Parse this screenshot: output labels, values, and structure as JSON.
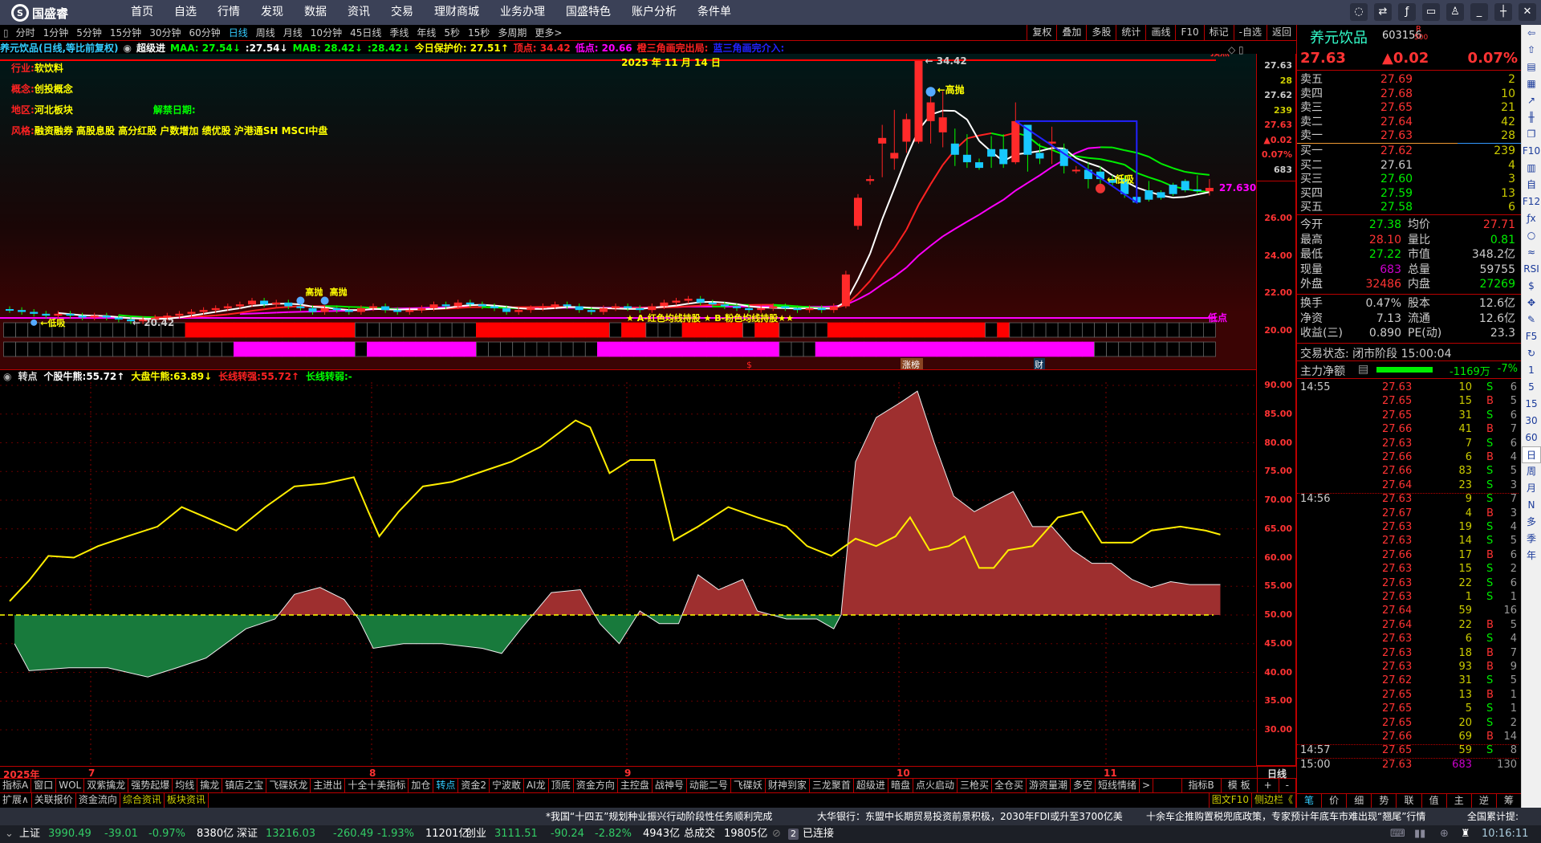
{
  "topbar": {
    "logo": "国盛睿",
    "menu": [
      "首页",
      "自选",
      "行情",
      "发现",
      "数据",
      "资讯",
      "交易",
      "理财商城",
      "业务办理",
      "国盛特色",
      "账户分析",
      "条件单"
    ],
    "window_icons": [
      "chat-icon",
      "swap-icon",
      "fx-icon",
      "monitor-icon",
      "shirt-icon",
      "minimize-icon",
      "restore-icon",
      "close-icon"
    ]
  },
  "periods": {
    "items": [
      "分时",
      "1分钟",
      "5分钟",
      "15分钟",
      "30分钟",
      "60分钟",
      "日线",
      "周线",
      "月线",
      "10分钟",
      "45日线",
      "季线",
      "年线",
      "5秒",
      "15秒",
      "多周期",
      "更多>"
    ],
    "active": "日线",
    "tools": [
      "复权",
      "叠加",
      "多股",
      "统计",
      "画线",
      "F10",
      "标记",
      "-自选",
      "返回"
    ]
  },
  "info": {
    "title": "养元饮品(日线,等比前复权)",
    "indicator": "超级进",
    "maa": "MAA: 27.54↓",
    "maa2": ":27.54↓",
    "mab": "MAB: 28.42↓",
    "mab2": ":28.42↓",
    "protect": "今日保护价: 27.51↑",
    "top": "顶点: 34.42",
    "low": "低点: 20.66",
    "orange_tri": "橙三角画完出局:",
    "blue_tri": "蓝三角画完介入:"
  },
  "overlay": {
    "industry_k": "行业:",
    "industry": "软饮料",
    "concept_k": "概念:",
    "concept": "创投概念",
    "region_k": "地区:",
    "region": "河北板块",
    "unlock_k": "解禁日期:",
    "style_k": "风格:",
    "style": "融资融券 高股息股 高分红股 户数增加 绩优股 沪港通SH MSCI中盘"
  },
  "chart_labels": {
    "date": "2025 年 11 月 14 日",
    "peak": "34.42",
    "low": "20.42",
    "last": "27.630",
    "sell_top": "顶点",
    "buy_low": "低点",
    "high_sell": "高抛",
    "low_buy": "低吸",
    "legend": "★ A-红色均线持股 ★ B-粉色均线持股★★",
    "marker_dollar": "$",
    "marker_rank": "涨榜",
    "marker_fin": "财"
  },
  "price_axis": {
    "quote": [
      "27.63",
      "28",
      "27.62",
      "239",
      "27.63",
      "▲0.02",
      "0.07%",
      "683"
    ],
    "ticks": [
      "26.00",
      "24.00",
      "22.00",
      "20.00"
    ]
  },
  "candles": {
    "flat_closes": [
      21.1,
      21.0,
      20.9,
      20.8,
      20.9,
      20.8,
      20.7,
      20.8,
      20.7,
      20.6,
      20.5,
      20.6,
      20.7,
      20.8,
      20.9,
      21.0,
      21.1,
      21.2,
      21.3,
      21.4,
      21.6,
      21.4,
      21.5,
      21.3,
      21.2,
      21.0,
      21.2,
      21.1,
      21.0,
      21.2,
      21.3,
      21.1,
      21.0,
      21.1,
      21.2,
      21.4,
      21.3,
      21.5,
      21.4,
      21.3,
      21.2,
      21.0,
      21.1,
      21.2,
      21.3,
      21.4,
      21.3,
      21.1,
      21.0,
      21.2,
      21.3,
      21.2,
      21.1,
      21.3,
      21.5,
      21.6,
      21.7,
      21.5,
      21.4,
      21.3,
      21.2,
      21.1,
      21.2,
      21.3,
      21.2,
      21.1,
      21.2,
      21.1,
      21.3
    ],
    "ohlc_tail": [
      [
        21.3,
        23.0,
        23.2,
        21.2
      ],
      [
        25.6,
        27.1,
        27.3,
        25.4
      ],
      [
        28.0,
        28.1,
        28.3,
        27.8
      ],
      [
        30.0,
        30.3,
        31.0,
        28.2
      ],
      [
        29.2,
        29.5,
        31.8,
        28.6
      ],
      [
        30.1,
        31.3,
        31.6,
        29.5
      ],
      [
        30.1,
        34.42,
        34.42,
        30.0
      ],
      [
        31.2,
        32.2,
        32.6,
        30.0
      ],
      [
        30.6,
        31.4,
        32.8,
        29.8
      ],
      [
        30.0,
        29.4,
        30.8,
        28.8
      ],
      [
        29.4,
        29.0,
        30.5,
        28.7
      ],
      [
        29.0,
        28.7,
        29.2,
        28.6
      ],
      [
        29.7,
        29.3,
        30.4,
        28.7
      ],
      [
        29.7,
        28.9,
        30.5,
        28.7
      ],
      [
        29.0,
        31.2,
        32.2,
        28.9
      ],
      [
        31.0,
        29.4,
        31.0,
        28.5
      ],
      [
        29.5,
        29.2,
        30.0,
        28.9
      ],
      [
        30.0,
        30.1,
        30.9,
        28.9
      ],
      [
        29.7,
        28.8,
        30.0,
        28.4
      ],
      [
        28.6,
        28.6,
        28.8,
        28.4
      ],
      [
        28.6,
        28.1,
        29.0,
        27.6
      ],
      [
        28.5,
        28.1,
        28.8,
        27.8
      ],
      [
        28.1,
        27.9,
        28.3,
        27.7
      ],
      [
        28.1,
        27.3,
        28.3,
        27.1
      ],
      [
        27.15,
        26.85,
        27.2,
        26.8
      ],
      [
        27.5,
        27.0,
        28.0,
        26.9
      ],
      [
        27.4,
        27.1,
        27.5,
        27.0
      ],
      [
        27.8,
        27.3,
        27.9,
        27.2
      ],
      [
        28.0,
        27.5,
        28.1,
        27.4
      ],
      [
        27.55,
        27.5,
        28.3,
        27.3
      ],
      [
        27.45,
        27.63,
        28.1,
        27.22
      ]
    ]
  },
  "signal_rows": {
    "red_runs": [
      [
        15,
        29
      ],
      [
        39,
        50
      ],
      [
        51,
        53
      ],
      [
        56,
        61
      ],
      [
        62,
        64
      ],
      [
        68,
        81
      ],
      [
        82,
        83
      ]
    ],
    "magenta_runs": [
      [
        19,
        29
      ],
      [
        30,
        39
      ],
      [
        49,
        64
      ],
      [
        67,
        90
      ]
    ],
    "count": 100
  },
  "colors": {
    "up": "#ff2a2a",
    "down": "#18c8ff",
    "red_row": "#ff0000",
    "magenta_row": "#ff00ff",
    "area_up": "#9e2f2f",
    "area_down": "#187a3c",
    "yellow": "#ffee00"
  },
  "indicator": {
    "name": "转点",
    "bull_k": "个股牛熊:",
    "bull": "55.72↑",
    "mkt_k": "大盘牛熊:",
    "mkt": "63.89↓",
    "strong_k": "长线转强:",
    "strong": "55.72↑",
    "weak_k": "长线转弱:",
    "weak": "-",
    "yellow_line": [
      [
        0,
        52.4
      ],
      [
        1.6,
        56
      ],
      [
        3.2,
        60.3
      ],
      [
        5.3,
        60
      ],
      [
        7.3,
        62
      ],
      [
        9.7,
        63.7
      ],
      [
        12.2,
        65.4
      ],
      [
        14.2,
        68.8
      ],
      [
        16.2,
        67
      ],
      [
        18.7,
        64.7
      ],
      [
        21.1,
        68.8
      ],
      [
        23.5,
        72.4
      ],
      [
        26,
        72.9
      ],
      [
        28.4,
        74
      ],
      [
        29.6,
        68
      ],
      [
        30.5,
        63.7
      ],
      [
        32.1,
        68
      ],
      [
        34.1,
        72.4
      ],
      [
        36.5,
        73.2
      ],
      [
        39,
        75
      ],
      [
        41.4,
        76.7
      ],
      [
        43.8,
        79.3
      ],
      [
        46.7,
        83.9
      ],
      [
        47.9,
        82.7
      ],
      [
        49.5,
        74.7
      ],
      [
        51.2,
        77
      ],
      [
        53.2,
        77
      ],
      [
        54.8,
        63
      ],
      [
        56.8,
        65.4
      ],
      [
        59.3,
        68.8
      ],
      [
        61.7,
        67
      ],
      [
        64.1,
        65.4
      ],
      [
        65.8,
        62
      ],
      [
        67.8,
        60.3
      ],
      [
        69.8,
        63.3
      ],
      [
        71.5,
        62
      ],
      [
        73.1,
        63.7
      ],
      [
        74.3,
        67
      ],
      [
        75.9,
        61.3
      ],
      [
        77.5,
        62
      ],
      [
        78.8,
        63.7
      ],
      [
        80,
        58.2
      ],
      [
        81.2,
        58.2
      ],
      [
        82.4,
        61.3
      ],
      [
        84.4,
        62
      ],
      [
        86.5,
        67
      ],
      [
        88.5,
        68
      ],
      [
        90.1,
        62.6
      ],
      [
        92.6,
        62.6
      ],
      [
        94.2,
        64.7
      ],
      [
        96.6,
        65.4
      ],
      [
        98.7,
        64.7
      ],
      [
        99.9,
        64
      ]
    ],
    "area_line": [
      [
        0.4,
        45
      ],
      [
        1.6,
        40.3
      ],
      [
        4.9,
        40.8
      ],
      [
        8.1,
        40.8
      ],
      [
        11.4,
        39.2
      ],
      [
        13.8,
        40.8
      ],
      [
        16.2,
        42.5
      ],
      [
        19.5,
        47.6
      ],
      [
        21.9,
        49.3
      ],
      [
        23.5,
        53.6
      ],
      [
        25.6,
        54.8
      ],
      [
        27.6,
        52.7
      ],
      [
        28.8,
        49.3
      ],
      [
        30,
        44.2
      ],
      [
        32.5,
        45
      ],
      [
        35.7,
        45
      ],
      [
        39,
        44.2
      ],
      [
        40.6,
        43.3
      ],
      [
        42.2,
        47.6
      ],
      [
        44.7,
        53.9
      ],
      [
        47.1,
        54.4
      ],
      [
        48.7,
        48.5
      ],
      [
        50.3,
        45
      ],
      [
        52,
        50.7
      ],
      [
        53.6,
        48.5
      ],
      [
        55.2,
        48.5
      ],
      [
        56.8,
        57
      ],
      [
        58.5,
        54.4
      ],
      [
        60.5,
        56.2
      ],
      [
        61.7,
        50.7
      ],
      [
        64.1,
        49.3
      ],
      [
        66.6,
        49.3
      ],
      [
        68,
        47.6
      ],
      [
        68.6,
        50
      ],
      [
        69.8,
        76.7
      ],
      [
        71.5,
        84.4
      ],
      [
        73.5,
        87
      ],
      [
        74.9,
        89
      ],
      [
        76.3,
        80
      ],
      [
        77.9,
        70.7
      ],
      [
        79.6,
        68
      ],
      [
        81.2,
        69.8
      ],
      [
        82.8,
        71.5
      ],
      [
        84.4,
        65.4
      ],
      [
        86,
        65.4
      ],
      [
        87.7,
        61.3
      ],
      [
        89.3,
        59
      ],
      [
        90.9,
        59
      ],
      [
        92.6,
        56.2
      ],
      [
        94.2,
        54.8
      ],
      [
        95.8,
        55.8
      ],
      [
        97.4,
        55.3
      ],
      [
        99.9,
        55.3
      ]
    ],
    "ticks": [
      "90.00",
      "85.00",
      "80.00",
      "75.00",
      "70.00",
      "65.00",
      "60.00",
      "55.00",
      "50.00",
      "45.00",
      "40.00",
      "35.00",
      "30.00"
    ]
  },
  "date_axis": {
    "year": "2025年",
    "months": [
      "7",
      "8",
      "9",
      "10",
      "11"
    ],
    "period": "日线"
  },
  "tabs_row1": [
    "指标A",
    "窗口",
    "WOL",
    "双紫擒龙",
    "强势起爆",
    "均线",
    "擒龙",
    "镇店之宝",
    "飞碟妖龙",
    "主进出",
    "十全十美指标",
    "加仓",
    "转点",
    "资金2",
    "宁波敢",
    "AI龙",
    "顶底",
    "资金方向",
    "主控盘",
    "战神号",
    "动能二号",
    "飞碟妖",
    "财神到家",
    "三龙聚首",
    "超级进",
    "暗盘",
    "点火启动",
    "三枪买",
    "全仓买",
    "游资量潮",
    "多空",
    "短线情绪",
    ">"
  ],
  "tabs_row1_right": [
    "指标B",
    "模 板",
    "+",
    "-"
  ],
  "tabs_row1_active": "转点",
  "tabs_row2": [
    "扩展∧",
    "关联报价",
    "资金流向",
    "综合资讯",
    "板块资讯"
  ],
  "tabs_row2_right": [
    "图文F10",
    "侧边栏《"
  ],
  "news": [
    "*我国“十四五”规划种业振兴行动阶段性任务顺利完成",
    "大华银行：东盟中长期贸易投资前景积极，2030年FDI或升至3700亿美",
    "十余车企推购置税兜底政策，专家预计年底车市难出现“翘尾”行情",
    "全国累计提:"
  ],
  "status": {
    "sh": [
      "上证",
      "3990.49",
      "-39.01",
      "-0.97%",
      "8380亿"
    ],
    "sz": [
      "深证",
      "13216.03",
      "-260.49",
      "-1.93%",
      "11201亿"
    ],
    "cy": [
      "创业",
      "3111.51",
      "-90.24",
      "-2.82%",
      "4943亿"
    ],
    "total_k": "总成交",
    "total": "19805亿",
    "conn_num": "2",
    "conn": "已连接",
    "time": "10:16:11"
  },
  "quote": {
    "name": "养元饮品",
    "code": "603156",
    "badge_r": "R",
    "badge_n": "500",
    "price": "27.63",
    "change": "▲0.02",
    "pct": "0.07%",
    "asks": [
      [
        "卖五",
        "27.69",
        "2"
      ],
      [
        "卖四",
        "27.68",
        "10"
      ],
      [
        "卖三",
        "27.65",
        "21"
      ],
      [
        "卖二",
        "27.64",
        "42"
      ],
      [
        "卖一",
        "27.63",
        "28"
      ]
    ],
    "bids": [
      [
        "买一",
        "27.62",
        "239"
      ],
      [
        "买二",
        "27.61",
        "4"
      ],
      [
        "买三",
        "27.60",
        "3"
      ],
      [
        "买四",
        "27.59",
        "13"
      ],
      [
        "买五",
        "27.58",
        "6"
      ]
    ],
    "stats": [
      [
        "今开",
        "27.38",
        "均价",
        "27.71"
      ],
      [
        "最高",
        "28.10",
        "量比",
        "0.81"
      ],
      [
        "最低",
        "27.22",
        "市值",
        "348.2亿"
      ],
      [
        "现量",
        "683",
        "总量",
        "59755"
      ],
      [
        "外盘",
        "32486",
        "内盘",
        "27269"
      ]
    ],
    "stats2": [
      [
        "换手",
        "0.47%",
        "股本",
        "12.6亿"
      ],
      [
        "净资",
        "7.13",
        "流通",
        "12.6亿"
      ],
      [
        "收益(三)",
        "0.890",
        "PE(动)",
        "23.3"
      ]
    ],
    "trade_state": "交易状态: 闭市阶段 15:00:04",
    "main_k": "主力净额",
    "main_v": "-1169万",
    "main_pct": "-7%"
  },
  "ticks_list": [
    [
      "14:55",
      "27.63",
      "10",
      "S",
      "6"
    ],
    [
      "",
      "27.65",
      "15",
      "B",
      "5"
    ],
    [
      "",
      "27.65",
      "31",
      "S",
      "6"
    ],
    [
      "",
      "27.66",
      "41",
      "B",
      "7"
    ],
    [
      "",
      "27.63",
      "7",
      "S",
      "6"
    ],
    [
      "",
      "27.66",
      "6",
      "B",
      "4"
    ],
    [
      "",
      "27.66",
      "83",
      "S",
      "5"
    ],
    [
      "",
      "27.64",
      "23",
      "S",
      "3"
    ],
    [
      "14:56",
      "27.63",
      "9",
      "S",
      "7"
    ],
    [
      "",
      "27.67",
      "4",
      "B",
      "3"
    ],
    [
      "",
      "27.63",
      "19",
      "S",
      "4"
    ],
    [
      "",
      "27.63",
      "14",
      "S",
      "5"
    ],
    [
      "",
      "27.66",
      "17",
      "B",
      "6"
    ],
    [
      "",
      "27.63",
      "15",
      "S",
      "2"
    ],
    [
      "",
      "27.63",
      "22",
      "S",
      "6"
    ],
    [
      "",
      "27.63",
      "1",
      "S",
      "1"
    ],
    [
      "",
      "27.64",
      "59",
      "",
      "16"
    ],
    [
      "",
      "27.64",
      "22",
      "B",
      "5"
    ],
    [
      "",
      "27.63",
      "6",
      "S",
      "4"
    ],
    [
      "",
      "27.63",
      "18",
      "B",
      "7"
    ],
    [
      "",
      "27.63",
      "93",
      "B",
      "9"
    ],
    [
      "",
      "27.62",
      "31",
      "S",
      "5"
    ],
    [
      "",
      "27.65",
      "13",
      "B",
      "1"
    ],
    [
      "",
      "27.65",
      "5",
      "S",
      "1"
    ],
    [
      "",
      "27.65",
      "20",
      "S",
      "2"
    ],
    [
      "",
      "27.66",
      "69",
      "B",
      "14"
    ],
    [
      "14:57",
      "27.65",
      "59",
      "S",
      "8"
    ],
    [
      "15:00",
      "27.63",
      "683",
      "",
      "130"
    ]
  ],
  "rpanel_tabs": [
    "笔",
    "价",
    "细",
    "势",
    "联",
    "值",
    "主",
    "逆",
    "筹"
  ],
  "sidebar": [
    "⇦",
    "⇧",
    "▤",
    "▦",
    "↗",
    "╫",
    "❐",
    "F10",
    "▥",
    "自",
    "F12",
    "ƒx",
    "○",
    "≈",
    "RSI",
    "$",
    "✥",
    "✎",
    "F5",
    "↻",
    "1",
    "5",
    "15",
    "30",
    "60",
    "日",
    "周",
    "月",
    "N",
    "多",
    "季",
    "年"
  ]
}
